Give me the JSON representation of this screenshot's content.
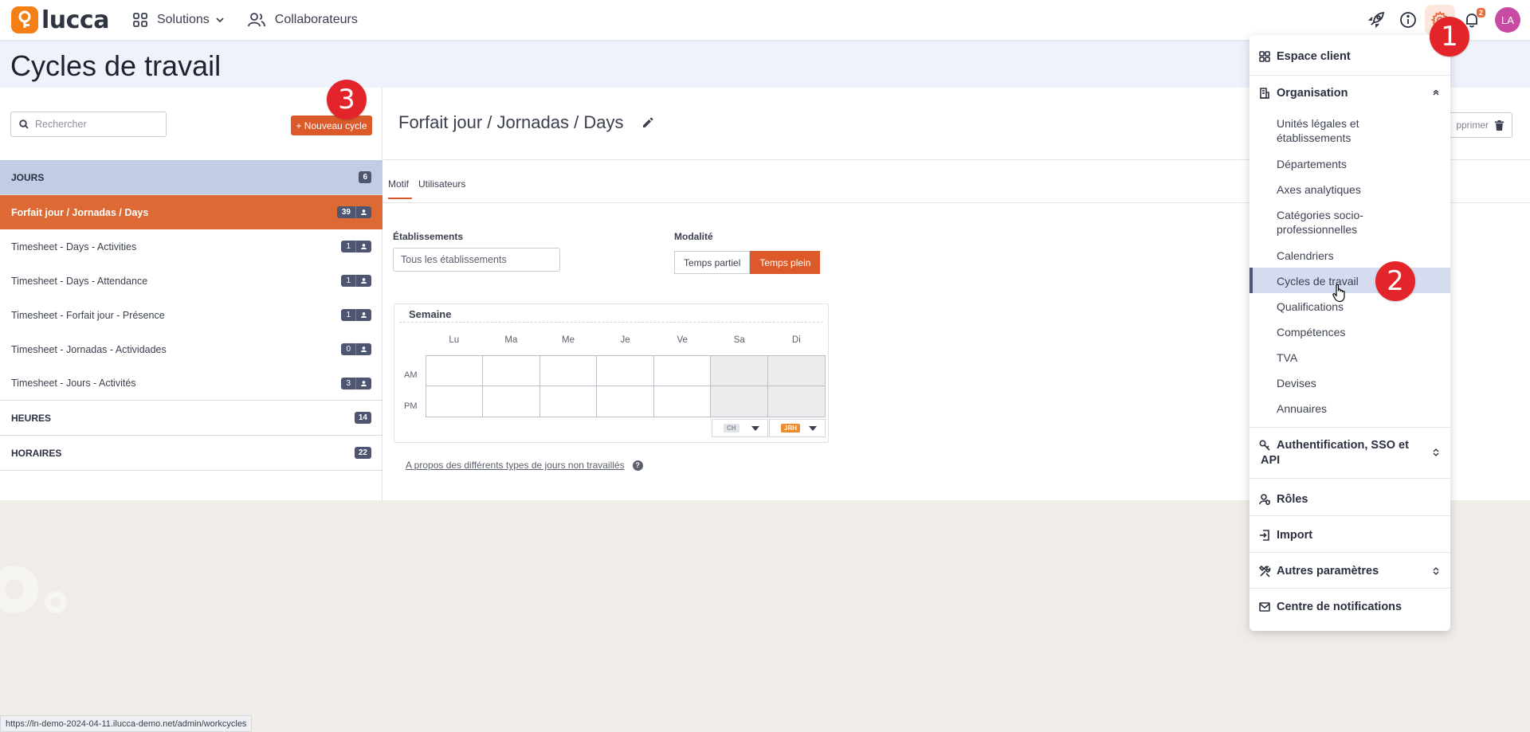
{
  "topbar": {
    "logo_text": "lucca",
    "nav": [
      {
        "label": "Solutions"
      },
      {
        "label": "Collaborateurs"
      }
    ],
    "notification_count": "2",
    "avatar_initials": "LA"
  },
  "page": {
    "title": "Cycles de travail"
  },
  "left": {
    "search_placeholder": "Rechercher",
    "new_button": "+ Nouveau cycle",
    "groups": [
      {
        "label": "JOURS",
        "count": "6",
        "items": [
          {
            "label": "Forfait jour / Jornadas / Days",
            "count": "39",
            "selected": true
          },
          {
            "label": "Timesheet - Days - Activities",
            "count": "1"
          },
          {
            "label": "Timesheet - Days - Attendance",
            "count": "1"
          },
          {
            "label": "Timesheet - Forfait jour - Présence",
            "count": "1"
          },
          {
            "label": "Timesheet - Jornadas - Actividades",
            "count": "0"
          },
          {
            "label": "Timesheet - Jours - Activités",
            "count": "3"
          }
        ]
      },
      {
        "label": "HEURES",
        "count": "14"
      },
      {
        "label": "HORAIRES",
        "count": "22"
      }
    ]
  },
  "detail": {
    "title": "Forfait jour / Jornadas / Days",
    "delete_label": "pprimer",
    "tabs": [
      "Motif",
      "Utilisateurs"
    ],
    "etablissements_label": "Établissements",
    "etablissements_value": "Tous les établissements",
    "modalite_label": "Modalité",
    "modalite_options": [
      "Temps partiel",
      "Temps plein"
    ],
    "modalite_selected": "Temps plein",
    "week": {
      "title": "Semaine",
      "days": [
        "Lu",
        "Ma",
        "Me",
        "Je",
        "Ve",
        "Sa",
        "Di"
      ],
      "rows": [
        "AM",
        "PM"
      ],
      "sa_code": "CH",
      "di_code": "JRH"
    },
    "about_link": "A propos des différents types de jours non travaillés"
  },
  "menu": {
    "espace_client": "Espace client",
    "organisation": "Organisation",
    "organisation_items": [
      "Unités légales et établissements",
      "Départements",
      "Axes analytiques",
      "Catégories socio-professionnelles",
      "Calendriers",
      "Cycles de travail",
      "Qualifications",
      "Compétences",
      "TVA",
      "Devises",
      "Annuaires"
    ],
    "active_item": "Cycles de travail",
    "auth": "Authentification, SSO et API",
    "roles": "Rôles",
    "import": "Import",
    "autres": "Autres paramètres",
    "notifications": "Centre de notifications"
  },
  "markers": [
    "1",
    "2",
    "3"
  ],
  "status_url": "https://ln-demo-2024-04-11.ilucca-demo.net/admin/workcycles",
  "colors": {
    "accent": "#dc5a2a",
    "selected_row": "#dd6a34",
    "group_header": "#c2cce4",
    "badge": "#4d5570",
    "marker": "#e3242b"
  }
}
